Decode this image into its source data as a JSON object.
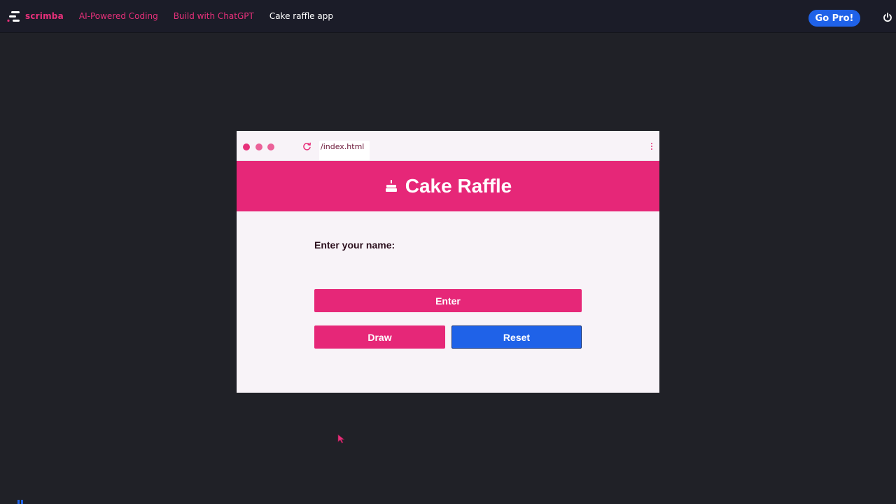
{
  "nav": {
    "logo_text": "scrimba",
    "breadcrumbs": [
      {
        "label": "AI-Powered Coding"
      },
      {
        "label": "Build with ChatGPT"
      },
      {
        "label": "Cake raffle app"
      }
    ],
    "go_pro_label": "Go Pro!"
  },
  "preview": {
    "url": "/index.html",
    "app": {
      "title": "Cake Raffle",
      "name_label": "Enter your name:",
      "enter_label": "Enter",
      "draw_label": "Draw",
      "reset_label": "Reset"
    }
  },
  "colors": {
    "brand_pink": "#e62778",
    "accent_blue": "#1f62e8",
    "background": "#202127"
  },
  "icons": [
    "scrimba-logo-icon",
    "power-icon",
    "reload-icon",
    "kebab-menu-icon",
    "cake-icon",
    "cursor-icon"
  ]
}
